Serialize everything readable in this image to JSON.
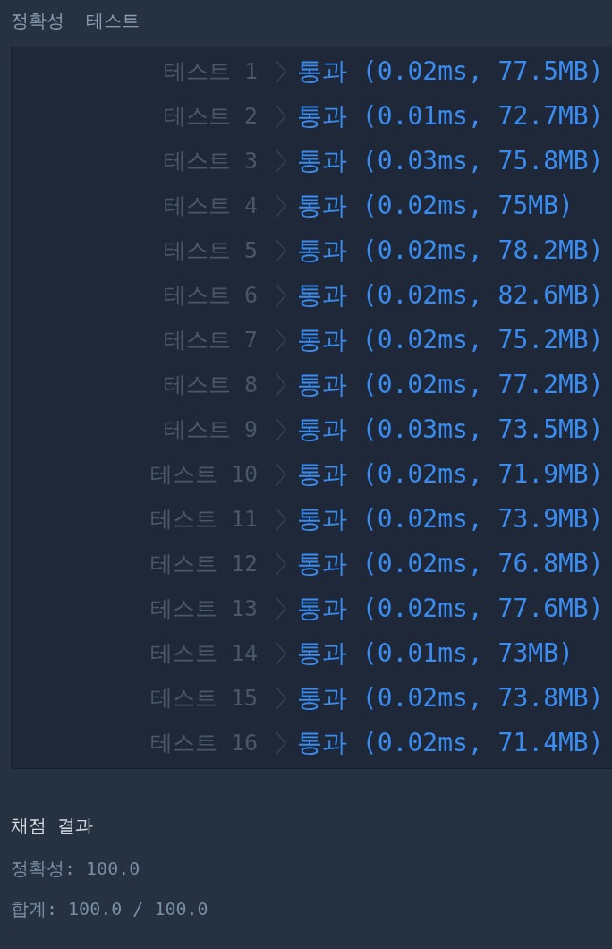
{
  "header": {
    "title": "정확성  테스트"
  },
  "tests": [
    {
      "label": "테스트 1",
      "result": "통과 (0.02ms, 77.5MB)"
    },
    {
      "label": "테스트 2",
      "result": "통과 (0.01ms, 72.7MB)"
    },
    {
      "label": "테스트 3",
      "result": "통과 (0.03ms, 75.8MB)"
    },
    {
      "label": "테스트 4",
      "result": "통과 (0.02ms, 75MB)"
    },
    {
      "label": "테스트 5",
      "result": "통과 (0.02ms, 78.2MB)"
    },
    {
      "label": "테스트 6",
      "result": "통과 (0.02ms, 82.6MB)"
    },
    {
      "label": "테스트 7",
      "result": "통과 (0.02ms, 75.2MB)"
    },
    {
      "label": "테스트 8",
      "result": "통과 (0.02ms, 77.2MB)"
    },
    {
      "label": "테스트 9",
      "result": "통과 (0.03ms, 73.5MB)"
    },
    {
      "label": "테스트 10",
      "result": "통과 (0.02ms, 71.9MB)"
    },
    {
      "label": "테스트 11",
      "result": "통과 (0.02ms, 73.9MB)"
    },
    {
      "label": "테스트 12",
      "result": "통과 (0.02ms, 76.8MB)"
    },
    {
      "label": "테스트 13",
      "result": "통과 (0.02ms, 77.6MB)"
    },
    {
      "label": "테스트 14",
      "result": "통과 (0.01ms, 73MB)"
    },
    {
      "label": "테스트 15",
      "result": "통과 (0.02ms, 73.8MB)"
    },
    {
      "label": "테스트 16",
      "result": "통과 (0.02ms, 71.4MB)"
    }
  ],
  "summary": {
    "title": "채점 결과",
    "lines": [
      "정확성: 100.0",
      "합계: 100.0 / 100.0"
    ]
  }
}
